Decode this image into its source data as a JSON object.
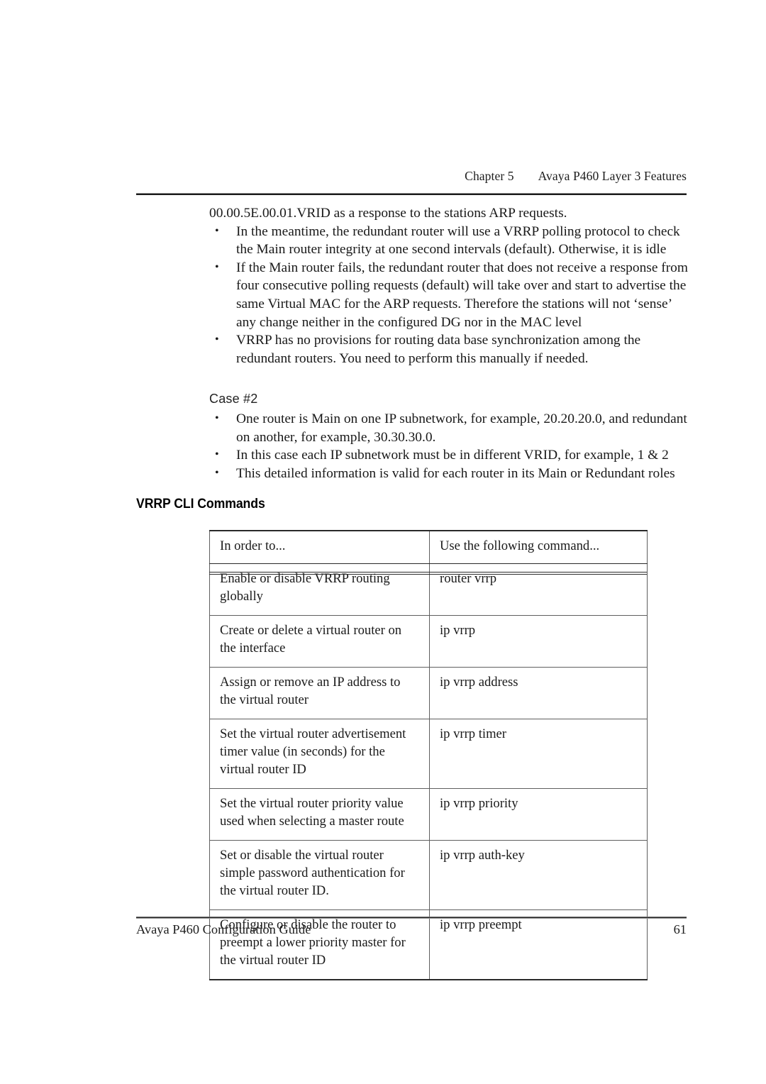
{
  "running_head": {
    "chapter_label": "Chapter 5",
    "title": "Avaya P460 Layer 3 Features"
  },
  "body": {
    "lead_paragraph": "00.00.5E.00.01.VRID as a response to the stations ARP requests.",
    "bullets": [
      "In the meantime, the redundant router will use a VRRP polling protocol to check the Main router integrity at one second intervals (default). Otherwise, it is idle",
      "If the Main router fails, the redundant router that does not receive a response from four consecutive polling requests (default) will take over and start to advertise the same Virtual MAC for the ARP requests. Therefore the stations will not ‘sense’ any change neither in the configured DG nor in the MAC level",
      "VRRP has no provisions for routing data base synchronization among the redundant routers. You need to perform this manually if needed."
    ]
  },
  "case_section": {
    "heading": "Case #2",
    "bullets": [
      "One router is Main on one IP subnetwork, for example, 20.20.20.0, and redundant on another, for example, 30.30.30.0.",
      "In this case each IP subnetwork must be in different VRID, for example, 1 & 2",
      "This detailed information is valid for each router in its Main or Redundant roles"
    ]
  },
  "section_heading": "VRRP CLI Commands",
  "table": {
    "headers": [
      "In order to...",
      "Use the following command..."
    ],
    "rows": [
      {
        "description": "Enable or disable VRRP routing globally",
        "command": "router vrrp"
      },
      {
        "description": "Create or delete a virtual router on the interface",
        "command": "ip vrrp"
      },
      {
        "description": "Assign or remove an IP address to the virtual router",
        "command": "ip vrrp address"
      },
      {
        "description": "Set the virtual router advertisement timer value (in seconds) for the virtual router ID",
        "command": "ip vrrp timer"
      },
      {
        "description": "Set the virtual router priority value used when selecting a master route",
        "command": "ip vrrp priority"
      },
      {
        "description": "Set or disable the virtual router simple password authentication for the virtual router ID.",
        "command": "ip vrrp auth-key"
      },
      {
        "description": "Configure or disable the router to preempt a lower priority master for the virtual router ID",
        "command": "ip vrrp preempt"
      }
    ]
  },
  "footer": {
    "document_title": "Avaya P460 Configuration Guide",
    "page_number": "61"
  }
}
